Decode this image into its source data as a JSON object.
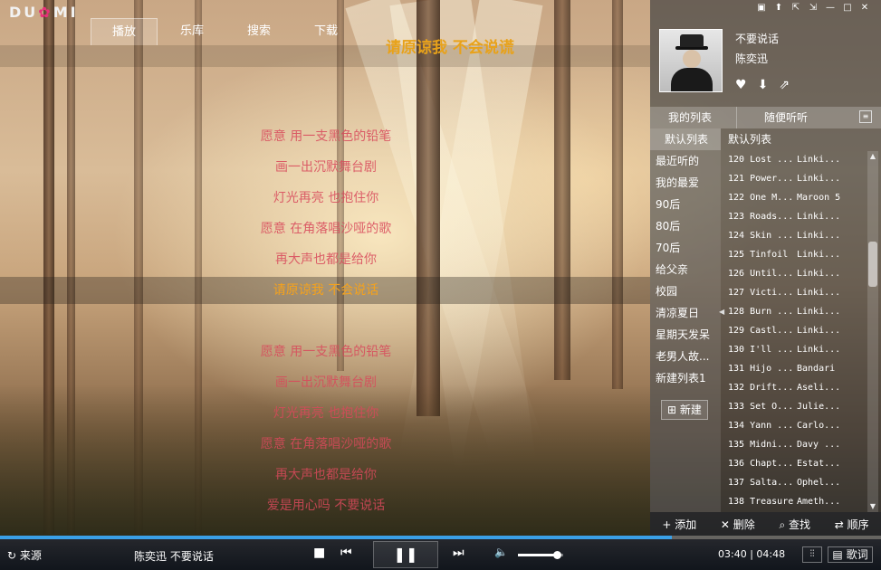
{
  "app": {
    "logo_text": "DU",
    "logo_dot": "✿",
    "logo_rest": "MI"
  },
  "tabs": [
    {
      "label": "播放",
      "active": true
    },
    {
      "label": "乐库",
      "active": false
    },
    {
      "label": "搜索",
      "active": false
    },
    {
      "label": "下载",
      "active": false
    }
  ],
  "window_controls": [
    "▣",
    "⬆",
    "⇱",
    "⇲",
    "—",
    "□",
    "✕"
  ],
  "song_title_banner": "请原谅我  不会说谎",
  "lyrics": [
    "愿意  用一支黑色的铅笔",
    "画一出沉默舞台剧",
    "灯光再亮  也抱住你",
    "愿意  在角落唱沙哑的歌",
    "再大声也都是给你",
    "请原谅我  不会说话",
    "愿意  用一支黑色的铅笔",
    "画一出沉默舞台剧",
    "灯光再亮  也抱住你",
    "愿意  在角落唱沙哑的歌",
    "再大声也都是给你",
    "爱是用心吗  不要说话"
  ],
  "current_lyric_index": 5,
  "now_playing": {
    "song": "不要说话",
    "artist": "陈奕迅",
    "actions": [
      "♥",
      "⬇",
      "⇗"
    ]
  },
  "list_tabs": {
    "my_list": "我的列表",
    "random": "随便听听"
  },
  "playlists": [
    "默认列表",
    "最近听的",
    "我的最爱",
    "90后",
    "80后",
    "70后",
    "给父亲",
    "校园",
    "清凉夏日",
    "星期天发呆",
    "老男人故...",
    "新建列表1"
  ],
  "selected_playlist_index": 0,
  "new_button": "新建",
  "tracks_header": "默认列表",
  "tracks": [
    {
      "title": "120 Lost ...",
      "artist": "Linki..."
    },
    {
      "title": "121 Power...",
      "artist": "Linki..."
    },
    {
      "title": "122 One M...",
      "artist": "Maroon 5"
    },
    {
      "title": "123 Roads...",
      "artist": "Linki..."
    },
    {
      "title": "124 Skin ...",
      "artist": "Linki..."
    },
    {
      "title": "125 Tinfoil",
      "artist": "Linki..."
    },
    {
      "title": "126 Until...",
      "artist": "Linki..."
    },
    {
      "title": "127 Victi...",
      "artist": "Linki..."
    },
    {
      "title": "128 Burn ...",
      "artist": "Linki..."
    },
    {
      "title": "129 Castl...",
      "artist": "Linki..."
    },
    {
      "title": "130 I'll ...",
      "artist": "Linki..."
    },
    {
      "title": "131 Hijo ...",
      "artist": "Bandari"
    },
    {
      "title": "132 Drift...",
      "artist": "Aseli..."
    },
    {
      "title": "133 Set O...",
      "artist": "Julie..."
    },
    {
      "title": "134 Yann ...",
      "artist": "Carlo..."
    },
    {
      "title": "135 Midni...",
      "artist": "Davy ..."
    },
    {
      "title": "136 Chapt...",
      "artist": "Estat..."
    },
    {
      "title": "137 Salta...",
      "artist": "Ophel..."
    },
    {
      "title": "138 Treasure",
      "artist": "Ameth..."
    }
  ],
  "list_actions": {
    "add": "+ 添加",
    "delete": "✕ 删除",
    "find": "⌕ 查找",
    "order": "⇄ 顺序"
  },
  "player": {
    "source": "来源",
    "now_info": "陈奕迅  不要说话",
    "current_time": "03:40",
    "total_time": "04:48",
    "lyric_button": "歌词",
    "progress": 0.763,
    "volume": 0.85
  },
  "colors": {
    "accent_lyric": "#f5a21c",
    "lyric_text": "#d9495b",
    "progress_fill": "#3aa0e8"
  }
}
